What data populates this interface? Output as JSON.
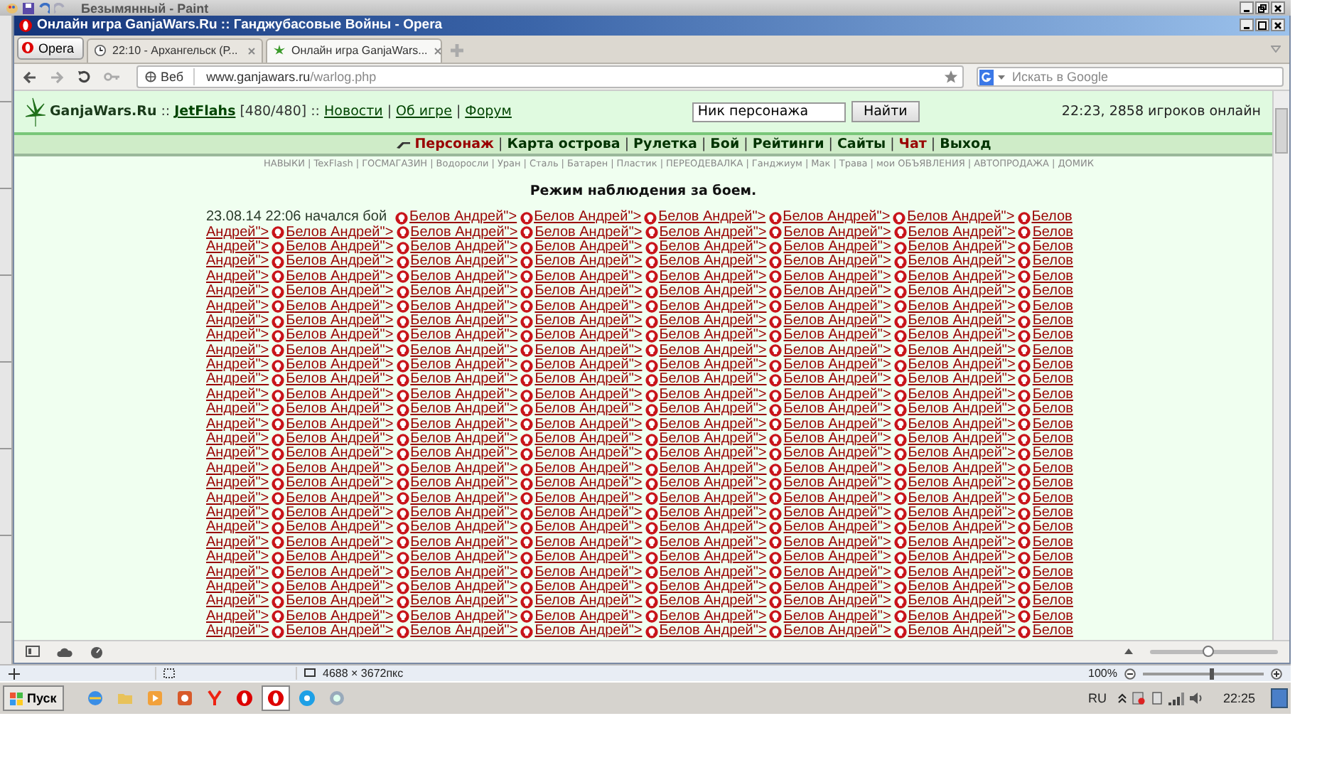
{
  "paint_window": {
    "title": "Безымянный - Paint",
    "status_size": "4688 × 3672пкс",
    "zoom": "100%",
    "zoom_slider": {
      "level": 0.57
    }
  },
  "browser": {
    "title": "Онлайн игра GanjaWars.Ru :: Ганджубасовые Войны - Opera",
    "menu_button": "Opera",
    "tabs": [
      {
        "label": "22:10 - Архангельск (Р...",
        "selected": false
      },
      {
        "label": "Онлайн игра GanjaWars...",
        "selected": true
      }
    ],
    "address": {
      "badge": "Веб",
      "host": "www.ganjawars.ru",
      "path": "/warlog.php"
    },
    "search": {
      "placeholder": "Искать в Google"
    },
    "zoom_slider": {
      "level": 0.45
    }
  },
  "header": {
    "site": "GanjaWars.Ru",
    "sep": "::",
    "user": "JetFlahs",
    "hp": "[480/480]",
    "sep2": "::",
    "separator": "|",
    "links": [
      "Новости",
      "Об игре",
      "Форум"
    ],
    "nick_value": "Ник персонажа",
    "find_button": "Найти",
    "online": "22:23, 2858 игроков онлайн"
  },
  "nav": {
    "separator": "|",
    "items": [
      {
        "label": "Персонаж",
        "highlighted": true
      },
      {
        "label": "Карта острова",
        "highlighted": false
      },
      {
        "label": "Рулетка",
        "highlighted": false
      },
      {
        "label": "Бой",
        "highlighted": false
      },
      {
        "label": "Рейтинги",
        "highlighted": false
      },
      {
        "label": "Сайты",
        "highlighted": false
      },
      {
        "label": "Чат",
        "highlighted": true
      },
      {
        "label": "Выход",
        "highlighted": false
      }
    ]
  },
  "subnav": {
    "separator": "|",
    "items": [
      "НАВЫКИ",
      "TexFlash",
      "ГОСМАГАЗИН",
      "Водоросли",
      "Уран",
      "Сталь",
      "Батарен",
      "Пластик",
      "ПЕРЕОДЕВАЛКА",
      "Ганджиум",
      "Мак",
      "Трава",
      "мои ОБЪЯВЛЕНИЯ",
      "АВТОПРОДАЖА",
      "ДОМИК"
    ]
  },
  "title": "Режим наблюдения за боем.",
  "log": [
    {
      "lead": {
        "kind": "text",
        "text": "23.08.14 22:06 начался бой"
      },
      "links": [
        "Белов Андрей\">",
        "Белов Андрей\">",
        "Белов Андрей\">",
        "Белов Андрей\">",
        "Белов Андрей\">"
      ],
      "tail": "Белов"
    },
    {
      "lead": {
        "kind": "link",
        "text": "Андрей\">"
      },
      "links": [
        "Белов Андрей\">",
        "Белов Андрей\">",
        "Белов Андрей\">",
        "Белов Андрей\">",
        "Белов Андрей\">",
        "Белов Андрей\">"
      ],
      "tail": "Белов"
    },
    {
      "lead": {
        "kind": "link",
        "text": "Андрей\">"
      },
      "links": [
        "Белов Андрей\">",
        "Белов Андрей\">",
        "Белов Андрей\">",
        "Белов Андрей\">",
        "Белов Андрей\">",
        "Белов Андрей\">"
      ],
      "tail": "Белов"
    },
    {
      "lead": {
        "kind": "link",
        "text": "Андрей\">"
      },
      "links": [
        "Белов Андрей\">",
        "Белов Андрей\">",
        "Белов Андрей\">",
        "Белов Андрей\">",
        "Белов Андрей\">",
        "Белов Андрей\">"
      ],
      "tail": "Белов"
    },
    {
      "lead": {
        "kind": "link",
        "text": "Андрей\">"
      },
      "links": [
        "Белов Андрей\">",
        "Белов Андрей\">",
        "Белов Андрей\">",
        "Белов Андрей\">",
        "Белов Андрей\">",
        "Белов Андрей\">"
      ],
      "tail": "Белов"
    },
    {
      "lead": {
        "kind": "link",
        "text": "Андрей\">"
      },
      "links": [
        "Белов Андрей\">",
        "Белов Андрей\">",
        "Белов Андрей\">",
        "Белов Андрей\">",
        "Белов Андрей\">",
        "Белов Андрей\">"
      ],
      "tail": "Белов"
    },
    {
      "lead": {
        "kind": "link",
        "text": "Андрей\">"
      },
      "links": [
        "Белов Андрей\">",
        "Белов Андрей\">",
        "Белов Андрей\">",
        "Белов Андрей\">",
        "Белов Андрей\">",
        "Белов Андрей\">"
      ],
      "tail": "Белов"
    },
    {
      "lead": {
        "kind": "link",
        "text": "Андрей\">"
      },
      "links": [
        "Белов Андрей\">",
        "Белов Андрей\">",
        "Белов Андрей\">",
        "Белов Андрей\">",
        "Белов Андрей\">",
        "Белов Андрей\">"
      ],
      "tail": "Белов"
    },
    {
      "lead": {
        "kind": "link",
        "text": "Андрей\">"
      },
      "links": [
        "Белов Андрей\">",
        "Белов Андрей\">",
        "Белов Андрей\">",
        "Белов Андрей\">",
        "Белов Андрей\">",
        "Белов Андрей\">"
      ],
      "tail": "Белов"
    },
    {
      "lead": {
        "kind": "link",
        "text": "Андрей\">"
      },
      "links": [
        "Белов Андрей\">",
        "Белов Андрей\">",
        "Белов Андрей\">",
        "Белов Андрей\">",
        "Белов Андрей\">",
        "Белов Андрей\">"
      ],
      "tail": "Белов"
    },
    {
      "lead": {
        "kind": "link",
        "text": "Андрей\">"
      },
      "links": [
        "Белов Андрей\">",
        "Белов Андрей\">",
        "Белов Андрей\">",
        "Белов Андрей\">",
        "Белов Андрей\">",
        "Белов Андрей\">"
      ],
      "tail": "Белов"
    },
    {
      "lead": {
        "kind": "link",
        "text": "Андрей\">"
      },
      "links": [
        "Белов Андрей\">",
        "Белов Андрей\">",
        "Белов Андрей\">",
        "Белов Андрей\">",
        "Белов Андрей\">",
        "Белов Андрей\">"
      ],
      "tail": "Белов"
    },
    {
      "lead": {
        "kind": "link",
        "text": "Андрей\">"
      },
      "links": [
        "Белов Андрей\">",
        "Белов Андрей\">",
        "Белов Андрей\">",
        "Белов Андрей\">",
        "Белов Андрей\">",
        "Белов Андрей\">"
      ],
      "tail": "Белов"
    },
    {
      "lead": {
        "kind": "link",
        "text": "Андрей\">"
      },
      "links": [
        "Белов Андрей\">",
        "Белов Андрей\">",
        "Белов Андрей\">",
        "Белов Андрей\">",
        "Белов Андрей\">",
        "Белов Андрей\">"
      ],
      "tail": "Белов"
    },
    {
      "lead": {
        "kind": "link",
        "text": "Андрей\">"
      },
      "links": [
        "Белов Андрей\">",
        "Белов Андрей\">",
        "Белов Андрей\">",
        "Белов Андрей\">",
        "Белов Андрей\">",
        "Белов Андрей\">"
      ],
      "tail": "Белов"
    },
    {
      "lead": {
        "kind": "link",
        "text": "Андрей\">"
      },
      "links": [
        "Белов Андрей\">",
        "Белов Андрей\">",
        "Белов Андрей\">",
        "Белов Андрей\">",
        "Белов Андрей\">",
        "Белов Андрей\">"
      ],
      "tail": "Белов"
    },
    {
      "lead": {
        "kind": "link",
        "text": "Андрей\">"
      },
      "links": [
        "Белов Андрей\">",
        "Белов Андрей\">",
        "Белов Андрей\">",
        "Белов Андрей\">",
        "Белов Андрей\">",
        "Белов Андрей\">"
      ],
      "tail": "Белов"
    },
    {
      "lead": {
        "kind": "link",
        "text": "Андрей\">"
      },
      "links": [
        "Белов Андрей\">",
        "Белов Андрей\">",
        "Белов Андрей\">",
        "Белов Андрей\">",
        "Белов Андрей\">",
        "Белов Андрей\">"
      ],
      "tail": "Белов"
    },
    {
      "lead": {
        "kind": "link",
        "text": "Андрей\">"
      },
      "links": [
        "Белов Андрей\">",
        "Белов Андрей\">",
        "Белов Андрей\">",
        "Белов Андрей\">",
        "Белов Андрей\">",
        "Белов Андрей\">"
      ],
      "tail": "Белов"
    },
    {
      "lead": {
        "kind": "link",
        "text": "Андрей\">"
      },
      "links": [
        "Белов Андрей\">",
        "Белов Андрей\">",
        "Белов Андрей\">",
        "Белов Андрей\">",
        "Белов Андрей\">",
        "Белов Андрей\">"
      ],
      "tail": "Белов"
    },
    {
      "lead": {
        "kind": "link",
        "text": "Андрей\">"
      },
      "links": [
        "Белов Андрей\">",
        "Белов Андрей\">",
        "Белов Андрей\">",
        "Белов Андрей\">",
        "Белов Андрей\">",
        "Белов Андрей\">"
      ],
      "tail": "Белов"
    },
    {
      "lead": {
        "kind": "link",
        "text": "Андрей\">"
      },
      "links": [
        "Белов Андрей\">",
        "Белов Андрей\">",
        "Белов Андрей\">",
        "Белов Андрей\">",
        "Белов Андрей\">",
        "Белов Андрей\">"
      ],
      "tail": "Белов"
    },
    {
      "lead": {
        "kind": "link",
        "text": "Андрей\">"
      },
      "links": [
        "Белов Андрей\">",
        "Белов Андрей\">",
        "Белов Андрей\">",
        "Белов Андрей\">",
        "Белов Андрей\">",
        "Белов Андрей\">"
      ],
      "tail": "Белов"
    },
    {
      "lead": {
        "kind": "link",
        "text": "Андрей\">"
      },
      "links": [
        "Белов Андрей\">",
        "Белов Андрей\">",
        "Белов Андрей\">",
        "Белов Андрей\">",
        "Белов Андрей\">",
        "Белов Андрей\">"
      ],
      "tail": "Белов"
    },
    {
      "lead": {
        "kind": "link",
        "text": "Андрей\">"
      },
      "links": [
        "Белов Андрей\">",
        "Белов Андрей\">",
        "Белов Андрей\">",
        "Белов Андрей\">",
        "Белов Андрей\">",
        "Белов Андрей\">"
      ],
      "tail": "Белов"
    },
    {
      "lead": {
        "kind": "link",
        "text": "Андрей\">"
      },
      "links": [
        "Белов Андрей\">",
        "Белов Андрей\">",
        "Белов Андрей\">",
        "Белов Андрей\">",
        "Белов Андрей\">",
        "Белов Андрей\">"
      ],
      "tail": "Белов"
    },
    {
      "lead": {
        "kind": "link",
        "text": "Андрей\">"
      },
      "links": [
        "Белов Андрей\">",
        "Белов Андрей\">",
        "Белов Андрей\">",
        "Белов Андрей\">",
        "Белов Андрей\">",
        "Белов Андрей\">"
      ],
      "tail": "Белов"
    },
    {
      "lead": {
        "kind": "link",
        "text": "Андрей\">"
      },
      "links": [
        "Белов Андрей\">",
        "Белов Андрей\">",
        "Белов Андрей\">",
        "Белов Андрей\">",
        "Белов Андрей\">",
        "Белов Андрей\">"
      ],
      "tail": "Белов"
    },
    {
      "lead": {
        "kind": "link",
        "text": "Андрей\">"
      },
      "links": [
        "Белов Андрей\">",
        "Белов Андрей\">",
        "Белов Андрей\">",
        "Белов Андрей\">",
        "Белов Андрей\">",
        "Белов Андрей\">"
      ],
      "tail": "Белов"
    }
  ],
  "taskbar": {
    "start": "Пуск",
    "lang": "RU",
    "clock": "22:25"
  }
}
